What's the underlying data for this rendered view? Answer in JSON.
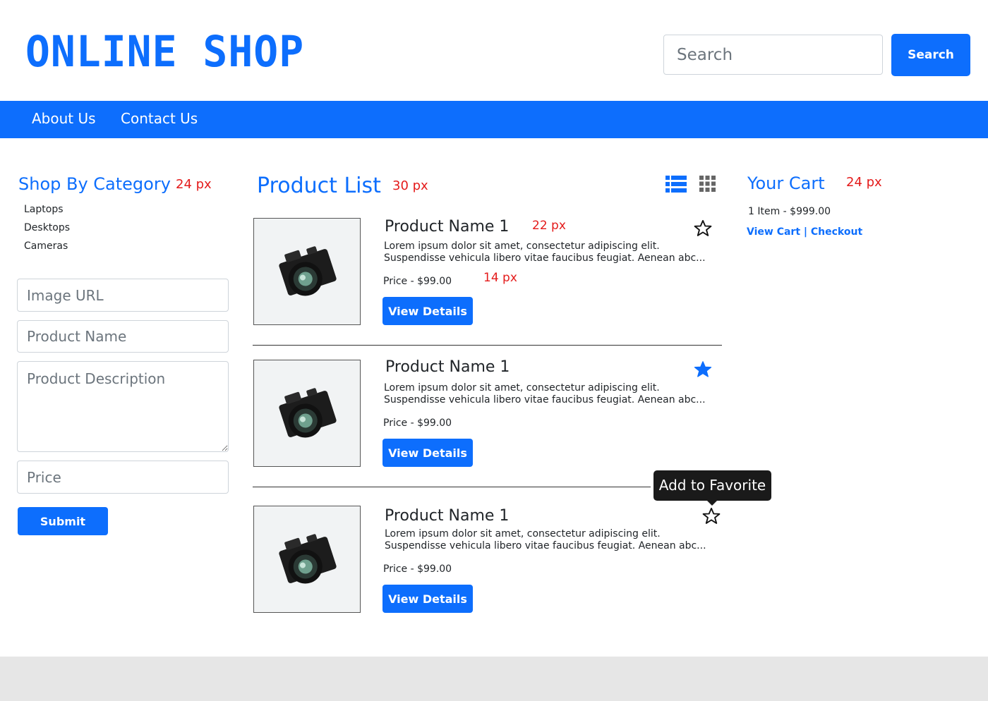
{
  "header": {
    "logo": "ONLINE SHOP",
    "search_placeholder": "Search",
    "search_button": "Search"
  },
  "nav": {
    "items": [
      {
        "label": "About Us"
      },
      {
        "label": "Contact Us"
      }
    ]
  },
  "sidebar": {
    "title": "Shop By Category",
    "title_note": "24 px",
    "categories": [
      "Laptops",
      "Desktops",
      "Cameras"
    ],
    "form": {
      "image_url_placeholder": "Image URL",
      "product_name_placeholder": "Product Name",
      "product_description_placeholder": "Product Description",
      "price_placeholder": "Price",
      "submit_label": "Submit"
    }
  },
  "main": {
    "title": "Product List",
    "title_note": "30 px",
    "name_note": "22 px",
    "price_note": "14 px",
    "products": [
      {
        "name": "Product Name 1",
        "description": "Lorem ipsum dolor sit amet, consectetur adipiscing elit. Suspendisse vehicula libero vitae faucibus feugiat. Aenean abc...",
        "price": "Price - $99.00",
        "button": "View Details",
        "favorite": false
      },
      {
        "name": "Product Name 1",
        "description": "Lorem ipsum dolor sit amet, consectetur adipiscing elit. Suspendisse vehicula libero vitae faucibus feugiat. Aenean abc...",
        "price": "Price - $99.00",
        "button": "View Details",
        "favorite": true
      },
      {
        "name": "Product Name 1",
        "description": "Lorem ipsum dolor sit amet, consectetur adipiscing elit. Suspendisse vehicula libero vitae faucibus feugiat. Aenean abc...",
        "price": "Price - $99.00",
        "button": "View Details",
        "favorite": false
      }
    ],
    "tooltip": "Add to Favorite",
    "icons": {
      "list_view": "list-view-icon",
      "grid_view": "grid-view-icon",
      "star_empty": "star-outline-icon",
      "star_filled": "star-filled-icon",
      "product_image": "camera-image"
    }
  },
  "cart": {
    "title": "Your Cart",
    "title_note": "24 px",
    "summary": "1 Item - $999.00",
    "view_cart": "View Cart",
    "separator": "|",
    "checkout": "Checkout"
  },
  "colors": {
    "primary": "#0d6efd",
    "annotation": "#e41b1b",
    "footer": "#e6e6e6",
    "tooltip": "#1a1a1a"
  }
}
